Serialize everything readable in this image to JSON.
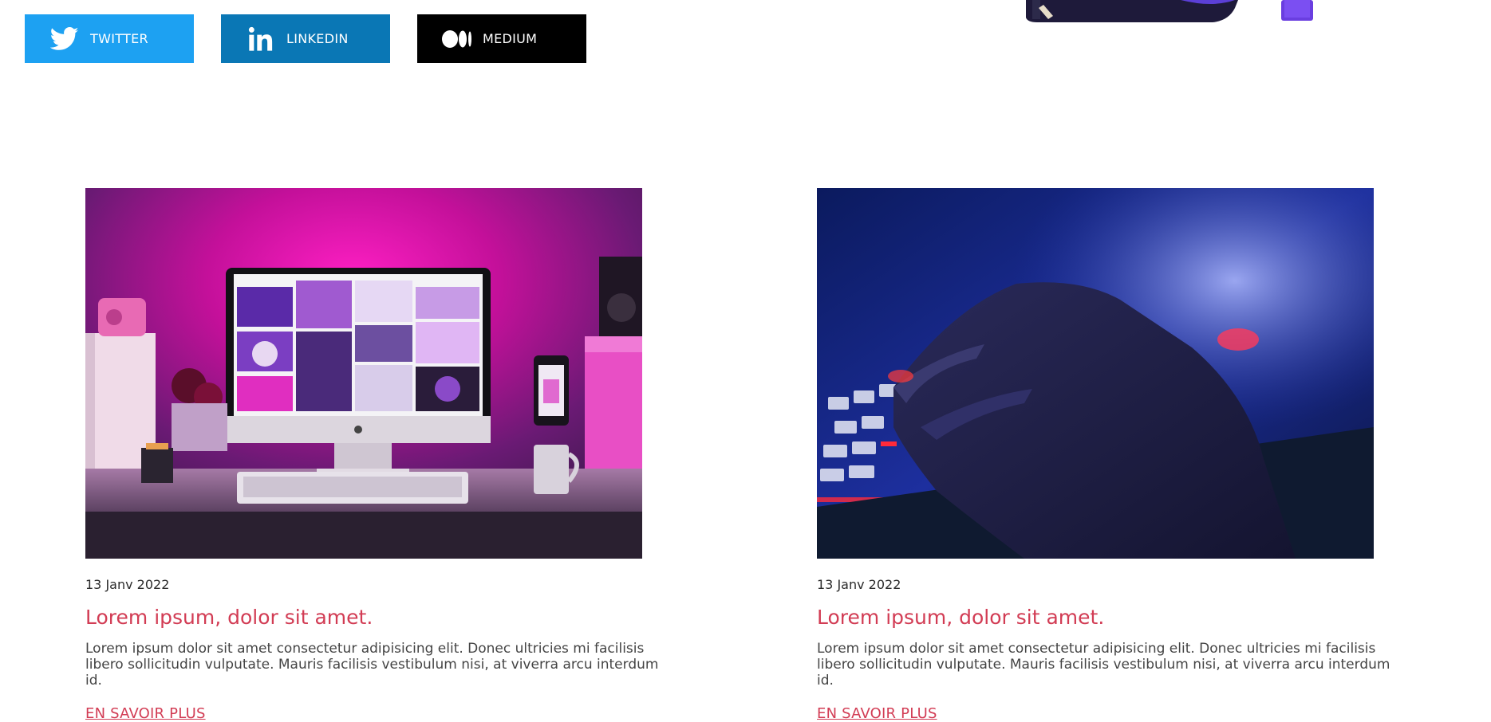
{
  "social": {
    "twitter": {
      "label": "TWITTER",
      "icon": "twitter-bird-icon",
      "color": "#1da1f2"
    },
    "linkedin": {
      "label": "LINKEDIN",
      "icon": "linkedin-in-icon",
      "color": "#0a77b5"
    },
    "medium": {
      "label": "MEDIUM",
      "icon": "medium-dots-icon",
      "color": "#000000"
    }
  },
  "articles": [
    {
      "date": "13 Janv 2022",
      "title": "Lorem ipsum, dolor sit amet.",
      "text": "Lorem ipsum dolor sit amet consectetur adipisicing elit. Donec ultricies mi facilisis libero sollicitudin vulputate. Mauris facilisis vestibulum nisi, at viverra arcu interdum id.",
      "link": "EN SAVOIR PLUS",
      "image": "desk-setup-pink-light-photo"
    },
    {
      "date": "13 Janv 2022",
      "title": "Lorem ipsum, dolor sit amet.",
      "text": "Lorem ipsum dolor sit amet consectetur adipisicing elit. Donec ultricies mi facilisis libero sollicitudin vulputate. Mauris facilisis vestibulum nisi, at viverra arcu interdum id.",
      "link": "EN SAVOIR PLUS",
      "image": "hand-on-backlit-keyboard-photo"
    }
  ],
  "colors": {
    "accent": "#d23c54",
    "text": "#444444"
  }
}
